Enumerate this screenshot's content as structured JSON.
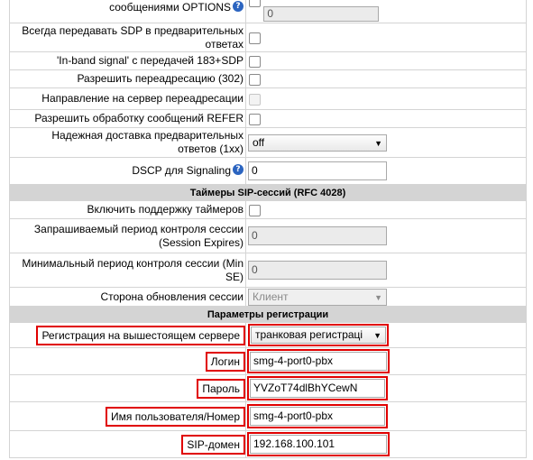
{
  "rows": {
    "options_label": "сообщениями OPTIONS",
    "options_value": "0",
    "sdp_label": "Всегда передавать SDP в предварительных ответах",
    "inband_label": "'In-band signal' с передачей 183+SDP",
    "redirect_label": "Разрешить переадресацию (302)",
    "redirect_dir_label": "Направление на сервер переадресации",
    "refer_label": "Разрешить обработку сообщений REFER",
    "reliable_label": "Надежная доставка предварительных ответов (1xx)",
    "reliable_value": "off",
    "dscp_label": "DSCP для Signaling",
    "dscp_value": "0"
  },
  "timers": {
    "section_title": "Таймеры SIP-сессий (RFC 4028)",
    "enable_label": "Включить поддержку таймеров",
    "session_expires_label": "Запрашиваемый период контроля сессии (Session Expires)",
    "session_expires_value": "0",
    "min_se_label": "Минимальный период контроля сессии (Min SE)",
    "min_se_value": "0",
    "refresher_label": "Сторона обновления сессии",
    "refresher_value": "Клиент"
  },
  "registration": {
    "section_title": "Параметры регистрации",
    "upstream_label": "Регистрация на вышестоящем сервере",
    "upstream_value": "транковая регистраці",
    "login_label": "Логин",
    "login_value": "smg-4-port0-pbx",
    "password_label": "Пароль",
    "password_value": "YVZoT74dlBhYCewN",
    "username_label": "Имя пользователя/Номер",
    "username_value": "smg-4-port0-pbx",
    "domain_label": "SIP-домен",
    "domain_value": "192.168.100.101"
  },
  "icons": {
    "help": "?",
    "dropdown": "▼"
  }
}
